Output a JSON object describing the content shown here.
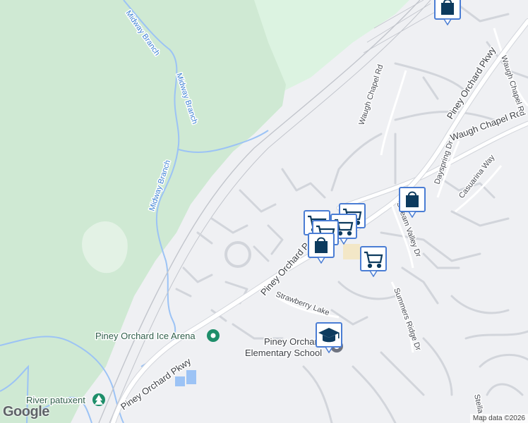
{
  "map": {
    "attribution": "Map data ©2026",
    "logo_text": "Google",
    "streets": {
      "piney_orchard_pkwy_ne": "Piney Orchard Pkwy",
      "piney_orchard_pkwy_mid": "Piney Orchard P",
      "piney_orchard_pkwy_sw": "Piney Orchard Pkwy",
      "waugh_chapel_rd_main": "Waugh Chapel Rd",
      "waugh_chapel_rd_north": "Waugh Chapel Rd",
      "waugh_chapel_rd_east": "Waugh Chapel Rd",
      "dayspring_dr": "Dayspring Dr",
      "casuarina_way": "Casuarina Way",
      "stream_valley_dr": "Stream Valley Dr",
      "summers_ridge_dr": "Summers Ridge Dr",
      "strawberry_lake": "Strawberry Lake",
      "stella_dr": "Stella Dr"
    },
    "water": {
      "midway_branch_1": "Midway Branch",
      "midway_branch_2": "Midway Branch",
      "midway_branch_3": "Midway Branch"
    },
    "pois": {
      "ice_arena": "Piney Orchard Ice Arena",
      "school_line1": "Piney Orchard",
      "school_line2": "Elementary School",
      "river": "River patuxent"
    },
    "markers": [
      {
        "type": "shopping-bag"
      },
      {
        "type": "shopping-bag"
      },
      {
        "type": "shopping-cart"
      },
      {
        "type": "shopping-cart"
      },
      {
        "type": "shopping-cart"
      },
      {
        "type": "shopping-cart"
      },
      {
        "type": "shopping-bag"
      },
      {
        "type": "shopping-cart"
      },
      {
        "type": "school"
      }
    ],
    "colors": {
      "forest": "#cfe9d3",
      "water": "#9cc3f5",
      "road": "#ffffff",
      "marker_bg": "#ffffff",
      "marker_border": "#4a7dd4",
      "marker_icon": "#0d3b5e"
    }
  }
}
